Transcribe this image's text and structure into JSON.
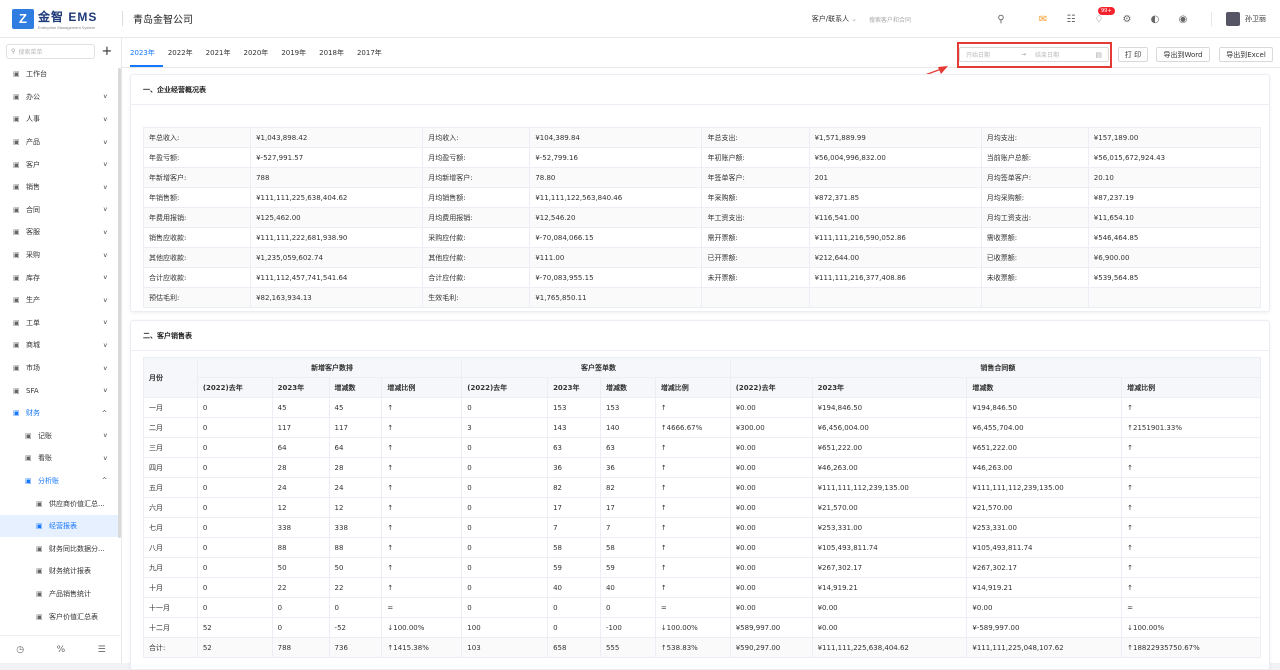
{
  "header": {
    "logo_mark": "Z",
    "logo_name": "金智 EMS",
    "logo_sub": "Enterprise Management System",
    "company": "青岛金智公司",
    "search_type": "客户/联系人",
    "search_placeholder": "搜索客户和合同",
    "notification_badge": "99+",
    "username": "孙卫丽"
  },
  "sidebar": {
    "search_placeholder": "搜索菜单",
    "items": [
      {
        "label": "工作台",
        "icon": "dashboard-icon",
        "chev": ""
      },
      {
        "label": "办公",
        "icon": "office-icon",
        "chev": "⌄"
      },
      {
        "label": "人事",
        "icon": "people-icon",
        "chev": "⌄"
      },
      {
        "label": "产品",
        "icon": "product-icon",
        "chev": "⌄"
      },
      {
        "label": "客户",
        "icon": "customer-icon",
        "chev": "⌄"
      },
      {
        "label": "销售",
        "icon": "sales-icon",
        "chev": "⌄"
      },
      {
        "label": "合同",
        "icon": "contract-icon",
        "chev": "⌄"
      },
      {
        "label": "客服",
        "icon": "service-icon",
        "chev": "⌄"
      },
      {
        "label": "采购",
        "icon": "purchase-icon",
        "chev": "⌄"
      },
      {
        "label": "库存",
        "icon": "stock-icon",
        "chev": "⌄"
      },
      {
        "label": "生产",
        "icon": "production-icon",
        "chev": "⌄"
      },
      {
        "label": "工单",
        "icon": "ticket-icon",
        "chev": "⌄"
      },
      {
        "label": "商城",
        "icon": "mall-icon",
        "chev": "⌄"
      },
      {
        "label": "市场",
        "icon": "market-icon",
        "chev": "⌄"
      },
      {
        "label": "SFA",
        "icon": "sfa-icon",
        "chev": "⌄"
      },
      {
        "label": "财务",
        "icon": "finance-icon",
        "chev": "⌃"
      }
    ],
    "finance_sub": [
      {
        "label": "记账",
        "chev": "⌄"
      },
      {
        "label": "看账",
        "chev": "⌄"
      },
      {
        "label": "分析账",
        "chev": "⌃"
      }
    ],
    "analysis_sub": [
      {
        "label": "供应商价值汇总..."
      },
      {
        "label": "经营报表"
      },
      {
        "label": "财务同比数据分..."
      },
      {
        "label": "财务统计报表"
      },
      {
        "label": "产品销售统计"
      },
      {
        "label": "客户价值汇总表"
      }
    ]
  },
  "year_tabs": [
    "2023年",
    "2022年",
    "2021年",
    "2020年",
    "2019年",
    "2018年",
    "2017年"
  ],
  "date_range": {
    "start_placeholder": "开始日期",
    "end_placeholder": "结束日期",
    "arrow": "→"
  },
  "buttons": {
    "print": "打 印",
    "export_word": "导出到Word",
    "export_excel": "导出到Excel"
  },
  "overview": {
    "title": "一、企业经营概况表",
    "rows": [
      [
        [
          "年总收入:",
          "¥1,043,898.42"
        ],
        [
          "月均收入:",
          "¥104,389.84"
        ],
        [
          "年总支出:",
          "¥1,571,889.99"
        ],
        [
          "月均支出:",
          "¥157,189.00"
        ]
      ],
      [
        [
          "年盈亏额:",
          "¥-527,991.57"
        ],
        [
          "月均盈亏额:",
          "¥-52,799.16"
        ],
        [
          "年初账户额:",
          "¥56,004,996,832.00"
        ],
        [
          "当前账户总额:",
          "¥56,015,672,924.43"
        ]
      ],
      [
        [
          "年新增客户:",
          "788"
        ],
        [
          "月均新增客户:",
          "78.80"
        ],
        [
          "年签单客户:",
          "201"
        ],
        [
          "月均签单客户:",
          "20.10"
        ]
      ],
      [
        [
          "年销售额:",
          "¥111,111,225,638,404.62"
        ],
        [
          "月均销售额:",
          "¥11,111,122,563,840.46"
        ],
        [
          "年采购额:",
          "¥872,371.85"
        ],
        [
          "月均采购额:",
          "¥87,237.19"
        ]
      ],
      [
        [
          "年费用报销:",
          "¥125,462.00"
        ],
        [
          "月均费用报销:",
          "¥12,546.20"
        ],
        [
          "年工资支出:",
          "¥116,541.00"
        ],
        [
          "月均工资支出:",
          "¥11,654.10"
        ]
      ],
      [
        [
          "销售应收款:",
          "¥111,111,222,681,938.90"
        ],
        [
          "采购应付款:",
          "¥-70,084,066.15"
        ],
        [
          "需开票额:",
          "¥111,111,216,590,052.86"
        ],
        [
          "需收票额:",
          "¥546,464.85"
        ]
      ],
      [
        [
          "其他应收款:",
          "¥1,235,059,602.74"
        ],
        [
          "其他应付款:",
          "¥111.00"
        ],
        [
          "已开票额:",
          "¥212,644.00"
        ],
        [
          "已收票额:",
          "¥6,900.00"
        ]
      ],
      [
        [
          "合计应收款:",
          "¥111,112,457,741,541.64"
        ],
        [
          "合计应付款:",
          "¥-70,083,955.15"
        ],
        [
          "未开票额:",
          "¥111,111,216,377,408.86"
        ],
        [
          "未收票额:",
          "¥539,564.85"
        ]
      ],
      [
        [
          "预估毛利:",
          "¥82,163,934.13"
        ],
        [
          "生效毛利:",
          "¥1,765,850.11"
        ],
        [
          "",
          ""
        ],
        [
          "",
          ""
        ]
      ]
    ]
  },
  "sales": {
    "title": "二、客户销售表",
    "month_header": "月份",
    "group_headers": [
      "新增客户数排",
      "客户签单数",
      "销售合同额"
    ],
    "sub_headers": [
      "(2022)去年",
      "2023年",
      "增减数",
      "增减比例"
    ],
    "rows": [
      [
        "一月",
        "0",
        "45",
        "45",
        "↑",
        "0",
        "153",
        "153",
        "↑",
        "¥0.00",
        "¥194,846.50",
        "¥194,846.50",
        "↑"
      ],
      [
        "二月",
        "0",
        "117",
        "117",
        "↑",
        "3",
        "143",
        "140",
        "↑4666.67%",
        "¥300.00",
        "¥6,456,004.00",
        "¥6,455,704.00",
        "↑2151901.33%"
      ],
      [
        "三月",
        "0",
        "64",
        "64",
        "↑",
        "0",
        "63",
        "63",
        "↑",
        "¥0.00",
        "¥651,222.00",
        "¥651,222.00",
        "↑"
      ],
      [
        "四月",
        "0",
        "28",
        "28",
        "↑",
        "0",
        "36",
        "36",
        "↑",
        "¥0.00",
        "¥46,263.00",
        "¥46,263.00",
        "↑"
      ],
      [
        "五月",
        "0",
        "24",
        "24",
        "↑",
        "0",
        "82",
        "82",
        "↑",
        "¥0.00",
        "¥111,111,112,239,135.00",
        "¥111,111,112,239,135.00",
        "↑"
      ],
      [
        "六月",
        "0",
        "12",
        "12",
        "↑",
        "0",
        "17",
        "17",
        "↑",
        "¥0.00",
        "¥21,570.00",
        "¥21,570.00",
        "↑"
      ],
      [
        "七月",
        "0",
        "338",
        "338",
        "↑",
        "0",
        "7",
        "7",
        "↑",
        "¥0.00",
        "¥253,331.00",
        "¥253,331.00",
        "↑"
      ],
      [
        "八月",
        "0",
        "88",
        "88",
        "↑",
        "0",
        "58",
        "58",
        "↑",
        "¥0.00",
        "¥105,493,811.74",
        "¥105,493,811.74",
        "↑"
      ],
      [
        "九月",
        "0",
        "50",
        "50",
        "↑",
        "0",
        "59",
        "59",
        "↑",
        "¥0.00",
        "¥267,302.17",
        "¥267,302.17",
        "↑"
      ],
      [
        "十月",
        "0",
        "22",
        "22",
        "↑",
        "0",
        "40",
        "40",
        "↑",
        "¥0.00",
        "¥14,919.21",
        "¥14,919.21",
        "↑"
      ],
      [
        "十一月",
        "0",
        "0",
        "0",
        "=",
        "0",
        "0",
        "0",
        "=",
        "¥0.00",
        "¥0.00",
        "¥0.00",
        "="
      ],
      [
        "十二月",
        "52",
        "0",
        "-52",
        "↓100.00%",
        "100",
        "0",
        "-100",
        "↓100.00%",
        "¥589,997.00",
        "¥0.00",
        "¥-589,997.00",
        "↓100.00%"
      ],
      [
        "合计:",
        "52",
        "788",
        "736",
        "↑1415.38%",
        "103",
        "658",
        "555",
        "↑538.83%",
        "¥590,297.00",
        "¥111,111,225,638,404.62",
        "¥111,111,225,048,107.62",
        "↑18822935750.67%"
      ]
    ]
  },
  "colors": {
    "accent": "#1677ff",
    "highlight_box": "#e53935",
    "badge": "#f5222d"
  }
}
